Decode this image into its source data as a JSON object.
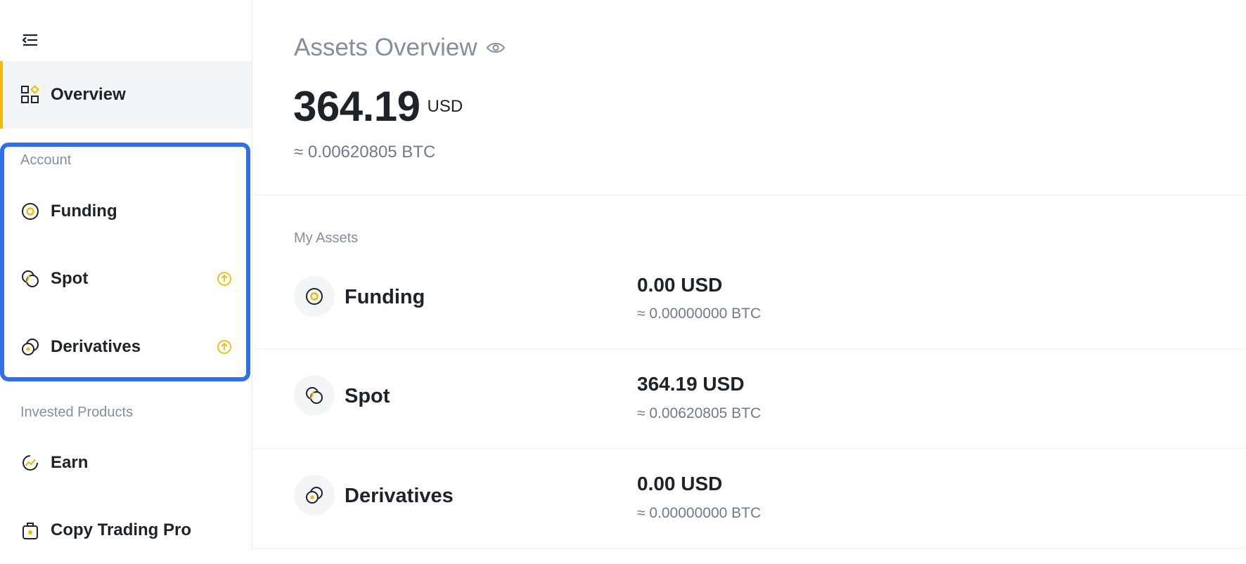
{
  "sidebar": {
    "overview_label": "Overview",
    "account_section": "Account",
    "account_items": [
      {
        "label": "Funding"
      },
      {
        "label": "Spot"
      },
      {
        "label": "Derivatives"
      }
    ],
    "invested_section": "Invested Products",
    "invested_items": [
      {
        "label": "Earn"
      },
      {
        "label": "Copy Trading Pro"
      }
    ]
  },
  "header": {
    "title": "Assets Overview",
    "total_value": "364.19",
    "total_unit": "USD",
    "total_btc": "≈ 0.00620805 BTC"
  },
  "assets": {
    "section_title": "My Assets",
    "rows": [
      {
        "name": "Funding",
        "usd": "0.00 USD",
        "btc": "≈ 0.00000000 BTC"
      },
      {
        "name": "Spot",
        "usd": "364.19 USD",
        "btc": "≈ 0.00620805 BTC"
      },
      {
        "name": "Derivatives",
        "usd": "0.00 USD",
        "btc": "≈ 0.00000000 BTC"
      }
    ]
  },
  "colors": {
    "accent": "#f0b90b",
    "highlight": "#2f6fea",
    "muted": "#848e9c",
    "text": "#1e2329"
  }
}
